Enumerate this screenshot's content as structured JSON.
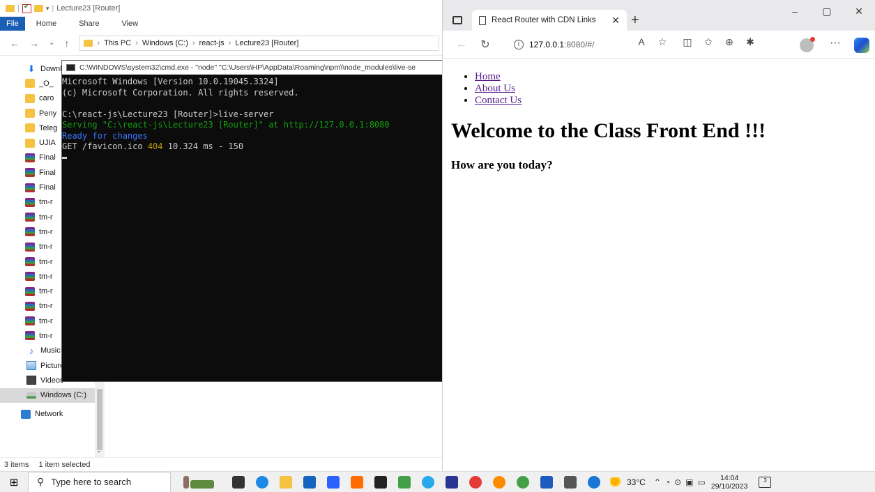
{
  "explorer": {
    "title": "Lecture23 [Router]",
    "ribbon_tabs": [
      "File",
      "Home",
      "Share",
      "View"
    ],
    "breadcrumb": [
      "This PC",
      "Windows (C:)",
      "react-js",
      "Lecture23 [Router]"
    ],
    "nav_items": [
      {
        "label": "Downl",
        "icon": "download-icon"
      },
      {
        "label": "_O_",
        "icon": "folder-icon"
      },
      {
        "label": "caro",
        "icon": "folder-icon"
      },
      {
        "label": "Peny",
        "icon": "folder-icon"
      },
      {
        "label": "Teleg",
        "icon": "folder-icon"
      },
      {
        "label": "UJIA",
        "icon": "folder-icon"
      },
      {
        "label": "Final",
        "icon": "rar-icon"
      },
      {
        "label": "Final",
        "icon": "rar-icon"
      },
      {
        "label": "Final",
        "icon": "rar-icon"
      },
      {
        "label": "tm-r",
        "icon": "rar-icon"
      },
      {
        "label": "tm-r",
        "icon": "rar-icon"
      },
      {
        "label": "tm-r",
        "icon": "rar-icon"
      },
      {
        "label": "tm-r",
        "icon": "rar-icon"
      },
      {
        "label": "tm-r",
        "icon": "rar-icon"
      },
      {
        "label": "tm-r",
        "icon": "rar-icon"
      },
      {
        "label": "tm-r",
        "icon": "rar-icon"
      },
      {
        "label": "tm-r",
        "icon": "rar-icon"
      },
      {
        "label": "tm-r",
        "icon": "rar-icon"
      },
      {
        "label": "tm-r",
        "icon": "rar-icon"
      },
      {
        "label": "Music",
        "icon": "music-icon"
      },
      {
        "label": "Pictures",
        "icon": "pictures-icon"
      },
      {
        "label": "Videos",
        "icon": "videos-icon"
      },
      {
        "label": "Windows (C:)",
        "icon": "drive-icon",
        "selected": true
      },
      {
        "label": "Network",
        "icon": "network-icon"
      }
    ],
    "status": {
      "items": "3 items",
      "selected": "1 item selected"
    }
  },
  "cmd": {
    "title": "C:\\WINDOWS\\system32\\cmd.exe - \"node\"  \"C:\\Users\\HP\\AppData\\Roaming\\npm\\\\node_modules\\live-se",
    "lines": {
      "l1": "Microsoft Windows [Version 10.0.19045.3324]",
      "l2": "(c) Microsoft Corporation. All rights reserved.",
      "l3": "C:\\react-js\\Lecture23 [Router]>live-server",
      "l4": "Serving \"C:\\react-js\\Lecture23 [Router]\" at http://127.0.0.1:8080",
      "l5": "Ready for changes",
      "l6a": "GET /favicon.ico ",
      "l6b": "404",
      "l6c": " 10.324 ms - 150"
    }
  },
  "browser": {
    "tab_title": "React Router with CDN Links",
    "url_host": "127.0.0.1",
    "url_rest": ":8080/#/",
    "window_controls": [
      "–",
      "▢",
      "✕"
    ],
    "page": {
      "links": [
        "Home",
        "About Us",
        "Contact Us"
      ],
      "heading": "Welcome to the Class Front End !!!",
      "subheading": "How are you today?"
    }
  },
  "taskbar": {
    "search_placeholder": "Type here to search",
    "weather": "33°C",
    "time": "14:04",
    "date": "29/10/2023",
    "notifications": "3",
    "apps": [
      {
        "name": "task-view-icon",
        "color": "#333333"
      },
      {
        "name": "edge-icon",
        "color": "#1e88e5"
      },
      {
        "name": "file-explorer-icon",
        "color": "#f5c242"
      },
      {
        "name": "mail-icon",
        "color": "#1565c0"
      },
      {
        "name": "dropbox-icon",
        "color": "#2962ff"
      },
      {
        "name": "app-orange-icon",
        "color": "#ff6d00"
      },
      {
        "name": "bolt-icon",
        "color": "#222222"
      },
      {
        "name": "notepad-icon",
        "color": "#43a047"
      },
      {
        "name": "telegram-icon",
        "color": "#29a9eb"
      },
      {
        "name": "dev-icon",
        "color": "#283593"
      },
      {
        "name": "opera-icon",
        "color": "#e53935"
      },
      {
        "name": "chrome-profile-h-icon",
        "color": "#fb8c00"
      },
      {
        "name": "chrome-profile-icon",
        "color": "#43a047"
      },
      {
        "name": "word-icon",
        "color": "#1e5bbf"
      },
      {
        "name": "terminal-icon",
        "color": "#555555"
      },
      {
        "name": "help-icon",
        "color": "#1976d2"
      }
    ]
  }
}
